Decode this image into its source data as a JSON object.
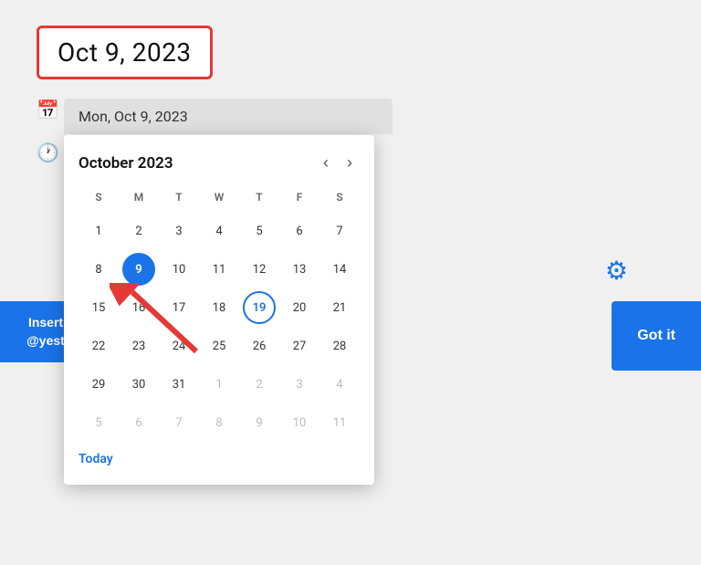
{
  "dateInput": {
    "label": "Oct 9, 2023",
    "borderColor": "#e53935"
  },
  "dateHeader": {
    "text": "Mon, Oct 9, 2023"
  },
  "calendar": {
    "monthLabel": "October 2023",
    "dayHeaders": [
      "S",
      "M",
      "T",
      "W",
      "T",
      "F",
      "S"
    ],
    "prevArrow": "‹",
    "nextArrow": "›",
    "weeks": [
      [
        {
          "label": "1",
          "type": "normal"
        },
        {
          "label": "2",
          "type": "normal"
        },
        {
          "label": "3",
          "type": "normal"
        },
        {
          "label": "4",
          "type": "normal"
        },
        {
          "label": "5",
          "type": "normal"
        },
        {
          "label": "6",
          "type": "normal"
        },
        {
          "label": "7",
          "type": "normal"
        }
      ],
      [
        {
          "label": "8",
          "type": "normal"
        },
        {
          "label": "9",
          "type": "selected"
        },
        {
          "label": "10",
          "type": "normal"
        },
        {
          "label": "11",
          "type": "normal"
        },
        {
          "label": "12",
          "type": "normal"
        },
        {
          "label": "13",
          "type": "normal"
        },
        {
          "label": "14",
          "type": "normal"
        }
      ],
      [
        {
          "label": "15",
          "type": "normal"
        },
        {
          "label": "16",
          "type": "normal"
        },
        {
          "label": "17",
          "type": "normal"
        },
        {
          "label": "18",
          "type": "normal"
        },
        {
          "label": "19",
          "type": "today"
        },
        {
          "label": "20",
          "type": "normal"
        },
        {
          "label": "21",
          "type": "normal"
        }
      ],
      [
        {
          "label": "22",
          "type": "normal"
        },
        {
          "label": "23",
          "type": "normal"
        },
        {
          "label": "24",
          "type": "normal"
        },
        {
          "label": "25",
          "type": "normal"
        },
        {
          "label": "26",
          "type": "normal"
        },
        {
          "label": "27",
          "type": "normal"
        },
        {
          "label": "28",
          "type": "normal"
        }
      ],
      [
        {
          "label": "29",
          "type": "normal"
        },
        {
          "label": "30",
          "type": "normal"
        },
        {
          "label": "31",
          "type": "normal"
        },
        {
          "label": "1",
          "type": "other"
        },
        {
          "label": "2",
          "type": "other"
        },
        {
          "label": "3",
          "type": "other"
        },
        {
          "label": "4",
          "type": "other"
        }
      ],
      [
        {
          "label": "5",
          "type": "other"
        },
        {
          "label": "6",
          "type": "other"
        },
        {
          "label": "7",
          "type": "other"
        },
        {
          "label": "8",
          "type": "other"
        },
        {
          "label": "9",
          "type": "other"
        },
        {
          "label": "10",
          "type": "other"
        },
        {
          "label": "11",
          "type": "other"
        }
      ]
    ],
    "todayLabel": "Today"
  },
  "insertButton": {
    "line1": "Insert",
    "line2": "@yest"
  },
  "gotItButton": {
    "label": "Got it"
  },
  "gearIcon": "⚙"
}
